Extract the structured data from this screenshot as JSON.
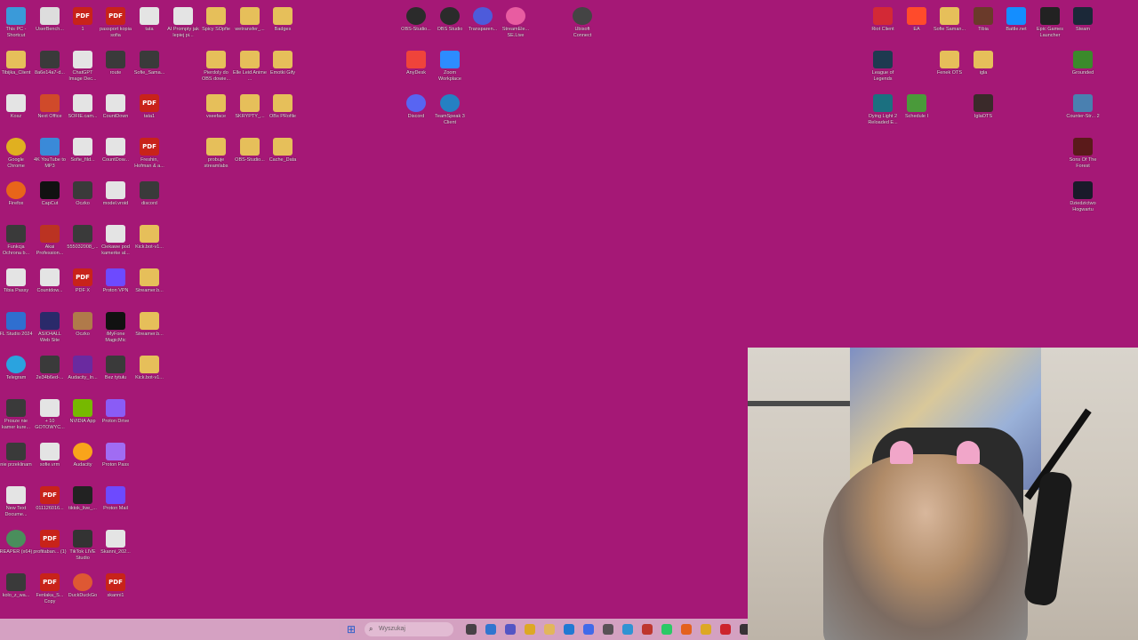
{
  "desktop": {
    "background_color": "#a51876",
    "icons": [
      {
        "label": "This PC - Shortcut",
        "icon": "pc-icon",
        "kind": "app"
      },
      {
        "label": "UserBench...",
        "icon": "benchmark-icon",
        "kind": "app"
      },
      {
        "label": "1",
        "icon": "pdf-icon",
        "kind": "pdf"
      },
      {
        "label": "passport kopia sofia",
        "icon": "pdf-icon",
        "kind": "pdf"
      },
      {
        "label": "tata",
        "icon": "image-icon",
        "kind": "file"
      },
      {
        "label": "AI Prompty jak lepiej pi...",
        "icon": "document-icon",
        "kind": "file"
      },
      {
        "label": "Spicy SOpfie",
        "icon": "folder-icon",
        "kind": "folder"
      },
      {
        "label": "wetransfer_...",
        "icon": "folder-icon",
        "kind": "folder"
      },
      {
        "label": "Badges",
        "icon": "folder-icon",
        "kind": "folder"
      },
      {
        "label": "Tibijka_Client",
        "icon": "folder-icon",
        "kind": "folder"
      },
      {
        "label": "8a6e14a7-d...",
        "icon": "image-icon",
        "kind": "app"
      },
      {
        "label": "ChatGPT Image Dec...",
        "icon": "image-icon",
        "kind": "file"
      },
      {
        "label": "route",
        "icon": "image-icon",
        "kind": "app"
      },
      {
        "label": "Sofie_Sama...",
        "icon": "app-icon",
        "kind": "app"
      },
      {
        "label": "Pierdoly do OBS dowie...",
        "icon": "folder-icon",
        "kind": "folder"
      },
      {
        "label": "Elle Leid Anime ...",
        "icon": "folder-icon",
        "kind": "folder"
      },
      {
        "label": "Emotki Gify",
        "icon": "folder-icon",
        "kind": "folder"
      },
      {
        "label": "Kosz",
        "icon": "recycle-bin-icon",
        "kind": "file"
      },
      {
        "label": "Next Office",
        "icon": "office-icon",
        "kind": "app"
      },
      {
        "label": "SOFIE.cam...",
        "icon": "document-icon",
        "kind": "file"
      },
      {
        "label": "CountDown",
        "icon": "document-icon",
        "kind": "file"
      },
      {
        "label": "tata1",
        "icon": "pdf-icon",
        "kind": "pdf"
      },
      {
        "label": "vseeface",
        "icon": "folder-icon",
        "kind": "folder"
      },
      {
        "label": "SKRYPTY_...",
        "icon": "folder-icon",
        "kind": "folder"
      },
      {
        "label": "OBs PRofile",
        "icon": "folder-icon",
        "kind": "folder"
      },
      {
        "label": "Google Chrome",
        "icon": "chrome-icon",
        "kind": "app"
      },
      {
        "label": "4K YouTube to MP3",
        "icon": "youtube-mp3-icon",
        "kind": "app"
      },
      {
        "label": "Sofie_fild...",
        "icon": "image-icon",
        "kind": "file"
      },
      {
        "label": "CountDow...",
        "icon": "document-icon",
        "kind": "file"
      },
      {
        "label": "Freshin, Hofman & a...",
        "icon": "pdf-icon",
        "kind": "pdf"
      },
      {
        "label": "probuje streamlabs",
        "icon": "folder-icon",
        "kind": "folder"
      },
      {
        "label": "OBS-Studio...",
        "icon": "folder-icon",
        "kind": "folder"
      },
      {
        "label": "Cache_Data",
        "icon": "folder-icon",
        "kind": "folder"
      },
      {
        "label": "Firefox",
        "icon": "firefox-icon",
        "kind": "app"
      },
      {
        "label": "CapCut",
        "icon": "capcut-icon",
        "kind": "app"
      },
      {
        "label": "Oczko",
        "icon": "image-icon",
        "kind": "app"
      },
      {
        "label": "model.vroid",
        "icon": "document-icon",
        "kind": "file"
      },
      {
        "label": "discord",
        "icon": "video-icon",
        "kind": "app"
      },
      {
        "label": "Funkcja Ochrona b...",
        "icon": "app-icon",
        "kind": "app"
      },
      {
        "label": "Akai Profession...",
        "icon": "akai-icon",
        "kind": "app"
      },
      {
        "label": "555032008_...",
        "icon": "image-icon",
        "kind": "app"
      },
      {
        "label": "Ciekawe pod kamerke al...",
        "icon": "monitor-icon",
        "kind": "file"
      },
      {
        "label": "Kick.bot-v1...",
        "icon": "folder-icon",
        "kind": "folder"
      },
      {
        "label": "Tibia Passy",
        "icon": "document-icon",
        "kind": "file"
      },
      {
        "label": "Countdow...",
        "icon": "document-icon",
        "kind": "file"
      },
      {
        "label": "PDF X",
        "icon": "pdfx-icon",
        "kind": "pdf"
      },
      {
        "label": "Proton VPN",
        "icon": "proton-vpn-icon",
        "kind": "app"
      },
      {
        "label": "Streamer.b...",
        "icon": "folder-icon",
        "kind": "folder"
      },
      {
        "label": "FL Studio 2024",
        "icon": "fl-studio-icon",
        "kind": "app"
      },
      {
        "label": "ASIO4ALL Web Site",
        "icon": "asio-icon",
        "kind": "app"
      },
      {
        "label": "Oczko",
        "icon": "eye-image-icon",
        "kind": "app"
      },
      {
        "label": "iMyFone MagicMic",
        "icon": "magicmic-icon",
        "kind": "app"
      },
      {
        "label": "Streamer.b...",
        "icon": "folder-icon",
        "kind": "folder"
      },
      {
        "label": "Telegram",
        "icon": "telegram-icon",
        "kind": "app"
      },
      {
        "label": "2e34b6ed-...",
        "icon": "image-icon",
        "kind": "app"
      },
      {
        "label": "Audacity_In...",
        "icon": "audacity-installer-icon",
        "kind": "app"
      },
      {
        "label": "Bez tytułu",
        "icon": "video-icon",
        "kind": "app"
      },
      {
        "label": "Kick.bot-v1...",
        "icon": "folder-icon",
        "kind": "folder"
      },
      {
        "label": "Prosze nie kamer kure...",
        "icon": "image-icon",
        "kind": "app"
      },
      {
        "label": "+ 10 GOTOWYC...",
        "icon": "document-icon",
        "kind": "file"
      },
      {
        "label": "NVIDIA App",
        "icon": "nvidia-icon",
        "kind": "app"
      },
      {
        "label": "Proton Drive",
        "icon": "proton-drive-icon",
        "kind": "app"
      },
      {
        "label": "nie przeklinam",
        "icon": "image-icon",
        "kind": "app"
      },
      {
        "label": "sofie.vrm",
        "icon": "document-icon",
        "kind": "file"
      },
      {
        "label": "Audacity",
        "icon": "audacity-icon",
        "kind": "app"
      },
      {
        "label": "Proton Pass",
        "icon": "proton-pass-icon",
        "kind": "app"
      },
      {
        "label": "New Text Docume...",
        "icon": "document-icon",
        "kind": "file"
      },
      {
        "label": "011126016...",
        "icon": "pdf-icon",
        "kind": "pdf"
      },
      {
        "label": "tiktok_live_...",
        "icon": "tiktok-icon",
        "kind": "app"
      },
      {
        "label": "Proton Mail",
        "icon": "proton-mail-icon",
        "kind": "app"
      },
      {
        "label": "REAPER (x64)",
        "icon": "reaper-icon",
        "kind": "app"
      },
      {
        "label": "profitaban... (1)",
        "icon": "pdf-icon",
        "kind": "pdf"
      },
      {
        "label": "TikTok LIVE Studio",
        "icon": "tiktok-live-icon",
        "kind": "app"
      },
      {
        "label": "Skanni_202...",
        "icon": "document-icon",
        "kind": "file"
      },
      {
        "label": "kolo_z_wa...",
        "icon": "app-icon",
        "kind": "app"
      },
      {
        "label": "Fenlaka_S... Copy",
        "icon": "pdf-icon",
        "kind": "pdf"
      },
      {
        "label": "DuckDuckGo",
        "icon": "duckduckgo-icon",
        "kind": "app"
      },
      {
        "label": "skanni1",
        "icon": "pdf-icon",
        "kind": "pdf"
      },
      {
        "label": "OBS-Studio...",
        "icon": "obs-icon",
        "kind": "app"
      },
      {
        "label": "OBS Studio",
        "icon": "obs-icon",
        "kind": "app"
      },
      {
        "label": "Transparen...",
        "icon": "transparent-icon",
        "kind": "app"
      },
      {
        "label": "StreamEle... SE.Live",
        "icon": "streamelements-icon",
        "kind": "app"
      },
      {
        "label": "Ubisoft Connect",
        "icon": "ubisoft-icon",
        "kind": "app"
      },
      {
        "label": "AnyDesk",
        "icon": "anydesk-icon",
        "kind": "app"
      },
      {
        "label": "Zoom Workplace",
        "icon": "zoom-icon",
        "kind": "app"
      },
      {
        "label": "Discord",
        "icon": "discord-icon",
        "kind": "app"
      },
      {
        "label": "TeamSpeak 3 Client",
        "icon": "teamspeak-icon",
        "kind": "app"
      },
      {
        "label": "Riot Client",
        "icon": "riot-icon",
        "kind": "app"
      },
      {
        "label": "EA",
        "icon": "ea-icon",
        "kind": "app"
      },
      {
        "label": "Sofie Saman...",
        "icon": "folder-icon",
        "kind": "folder"
      },
      {
        "label": "Tibia",
        "icon": "tibia-icon",
        "kind": "app"
      },
      {
        "label": "Battle.net",
        "icon": "battlenet-icon",
        "kind": "app"
      },
      {
        "label": "Epic Games Launcher",
        "icon": "epic-icon",
        "kind": "app"
      },
      {
        "label": "Steam",
        "icon": "steam-icon",
        "kind": "app"
      },
      {
        "label": "League of Legends",
        "icon": "league-icon",
        "kind": "app"
      },
      {
        "label": "Fenek OTS",
        "icon": "folder-icon",
        "kind": "folder"
      },
      {
        "label": "igla",
        "icon": "folder-icon",
        "kind": "folder"
      },
      {
        "label": "Grounded",
        "icon": "grounded-icon",
        "kind": "app"
      },
      {
        "label": "Dying Light 2 Reloaded E...",
        "icon": "dyinglight-icon",
        "kind": "app"
      },
      {
        "label": "Schedule I",
        "icon": "schedule-icon",
        "kind": "app"
      },
      {
        "label": "IglaOTS",
        "icon": "iglaots-icon",
        "kind": "app"
      },
      {
        "label": "Counter-Str... 2",
        "icon": "cs2-icon",
        "kind": "app"
      },
      {
        "label": "Sons Of The Forest",
        "icon": "sotf-icon",
        "kind": "app"
      },
      {
        "label": "Dziedzictwo Hogwartu",
        "icon": "hogwarts-icon",
        "kind": "app"
      }
    ]
  },
  "taskbar": {
    "search_placeholder": "Wyszukaj",
    "items": [
      "file-explorer-icon",
      "copilot-icon",
      "teams-icon",
      "chrome-icon",
      "file-manager-icon",
      "edge-icon",
      "messenger-icon",
      "calculator-icon",
      "app-icon",
      "brave-icon",
      "whatsapp-icon",
      "firefox-icon",
      "chrome-icon",
      "opera-icon",
      "app-icon"
    ]
  },
  "webcam": {
    "label": "webcam-feed"
  }
}
